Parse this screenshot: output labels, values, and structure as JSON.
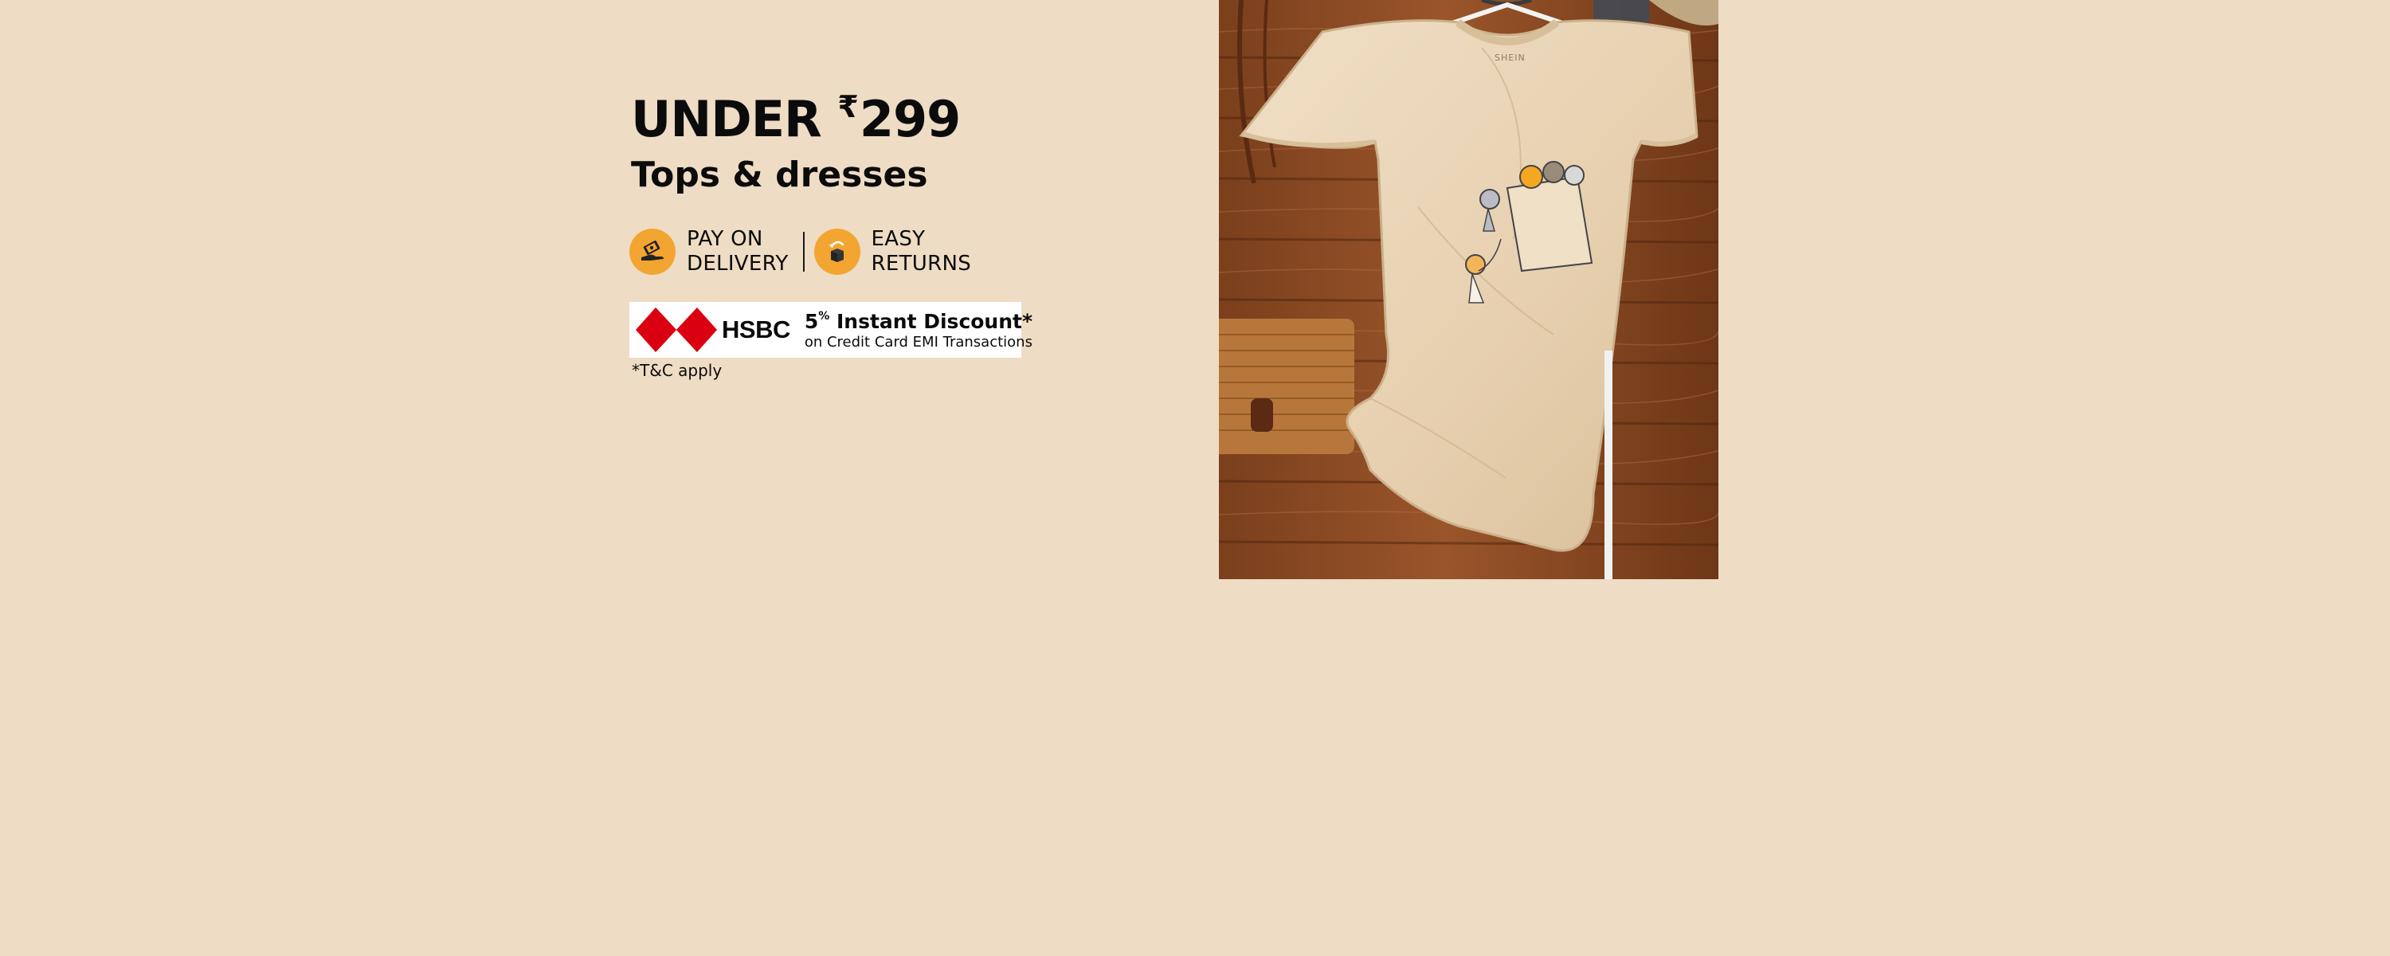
{
  "banner": {
    "headline": {
      "prefix": "UNDER",
      "currency": "₹",
      "amount": "299"
    },
    "subheadline": "Tops & dresses",
    "benefits": [
      {
        "line1": "PAY ON",
        "line2": "DELIVERY",
        "icon": "cash-on-delivery-icon"
      },
      {
        "line1": "EASY",
        "line2": "RETURNS",
        "icon": "return-box-icon"
      }
    ],
    "offer": {
      "bank": "HSBC",
      "discount_value": "5",
      "discount_unit": "%",
      "discount_text": " Instant Discount*",
      "detail": "on Credit Card EMI Transactions"
    },
    "terms": "*T&C apply",
    "product_image": {
      "garment_label": "SHEIN"
    },
    "colors": {
      "background": "#eedcc4",
      "icon_orange": "#f3a531",
      "hsbc_red": "#db0011",
      "tshirt": "#e8d3b6",
      "wood": "#8a4a22"
    }
  }
}
